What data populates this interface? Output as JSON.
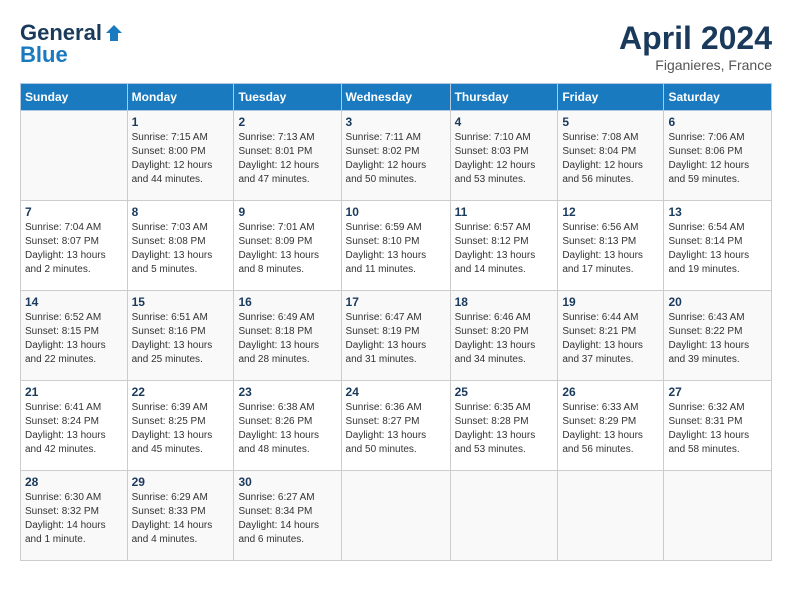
{
  "logo": {
    "general": "General",
    "blue": "Blue"
  },
  "title": "April 2024",
  "location": "Figanieres, France",
  "days_of_week": [
    "Sunday",
    "Monday",
    "Tuesday",
    "Wednesday",
    "Thursday",
    "Friday",
    "Saturday"
  ],
  "weeks": [
    [
      {
        "num": "",
        "sunrise": "",
        "sunset": "",
        "daylight": ""
      },
      {
        "num": "1",
        "sunrise": "Sunrise: 7:15 AM",
        "sunset": "Sunset: 8:00 PM",
        "daylight": "Daylight: 12 hours and 44 minutes."
      },
      {
        "num": "2",
        "sunrise": "Sunrise: 7:13 AM",
        "sunset": "Sunset: 8:01 PM",
        "daylight": "Daylight: 12 hours and 47 minutes."
      },
      {
        "num": "3",
        "sunrise": "Sunrise: 7:11 AM",
        "sunset": "Sunset: 8:02 PM",
        "daylight": "Daylight: 12 hours and 50 minutes."
      },
      {
        "num": "4",
        "sunrise": "Sunrise: 7:10 AM",
        "sunset": "Sunset: 8:03 PM",
        "daylight": "Daylight: 12 hours and 53 minutes."
      },
      {
        "num": "5",
        "sunrise": "Sunrise: 7:08 AM",
        "sunset": "Sunset: 8:04 PM",
        "daylight": "Daylight: 12 hours and 56 minutes."
      },
      {
        "num": "6",
        "sunrise": "Sunrise: 7:06 AM",
        "sunset": "Sunset: 8:06 PM",
        "daylight": "Daylight: 12 hours and 59 minutes."
      }
    ],
    [
      {
        "num": "7",
        "sunrise": "Sunrise: 7:04 AM",
        "sunset": "Sunset: 8:07 PM",
        "daylight": "Daylight: 13 hours and 2 minutes."
      },
      {
        "num": "8",
        "sunrise": "Sunrise: 7:03 AM",
        "sunset": "Sunset: 8:08 PM",
        "daylight": "Daylight: 13 hours and 5 minutes."
      },
      {
        "num": "9",
        "sunrise": "Sunrise: 7:01 AM",
        "sunset": "Sunset: 8:09 PM",
        "daylight": "Daylight: 13 hours and 8 minutes."
      },
      {
        "num": "10",
        "sunrise": "Sunrise: 6:59 AM",
        "sunset": "Sunset: 8:10 PM",
        "daylight": "Daylight: 13 hours and 11 minutes."
      },
      {
        "num": "11",
        "sunrise": "Sunrise: 6:57 AM",
        "sunset": "Sunset: 8:12 PM",
        "daylight": "Daylight: 13 hours and 14 minutes."
      },
      {
        "num": "12",
        "sunrise": "Sunrise: 6:56 AM",
        "sunset": "Sunset: 8:13 PM",
        "daylight": "Daylight: 13 hours and 17 minutes."
      },
      {
        "num": "13",
        "sunrise": "Sunrise: 6:54 AM",
        "sunset": "Sunset: 8:14 PM",
        "daylight": "Daylight: 13 hours and 19 minutes."
      }
    ],
    [
      {
        "num": "14",
        "sunrise": "Sunrise: 6:52 AM",
        "sunset": "Sunset: 8:15 PM",
        "daylight": "Daylight: 13 hours and 22 minutes."
      },
      {
        "num": "15",
        "sunrise": "Sunrise: 6:51 AM",
        "sunset": "Sunset: 8:16 PM",
        "daylight": "Daylight: 13 hours and 25 minutes."
      },
      {
        "num": "16",
        "sunrise": "Sunrise: 6:49 AM",
        "sunset": "Sunset: 8:18 PM",
        "daylight": "Daylight: 13 hours and 28 minutes."
      },
      {
        "num": "17",
        "sunrise": "Sunrise: 6:47 AM",
        "sunset": "Sunset: 8:19 PM",
        "daylight": "Daylight: 13 hours and 31 minutes."
      },
      {
        "num": "18",
        "sunrise": "Sunrise: 6:46 AM",
        "sunset": "Sunset: 8:20 PM",
        "daylight": "Daylight: 13 hours and 34 minutes."
      },
      {
        "num": "19",
        "sunrise": "Sunrise: 6:44 AM",
        "sunset": "Sunset: 8:21 PM",
        "daylight": "Daylight: 13 hours and 37 minutes."
      },
      {
        "num": "20",
        "sunrise": "Sunrise: 6:43 AM",
        "sunset": "Sunset: 8:22 PM",
        "daylight": "Daylight: 13 hours and 39 minutes."
      }
    ],
    [
      {
        "num": "21",
        "sunrise": "Sunrise: 6:41 AM",
        "sunset": "Sunset: 8:24 PM",
        "daylight": "Daylight: 13 hours and 42 minutes."
      },
      {
        "num": "22",
        "sunrise": "Sunrise: 6:39 AM",
        "sunset": "Sunset: 8:25 PM",
        "daylight": "Daylight: 13 hours and 45 minutes."
      },
      {
        "num": "23",
        "sunrise": "Sunrise: 6:38 AM",
        "sunset": "Sunset: 8:26 PM",
        "daylight": "Daylight: 13 hours and 48 minutes."
      },
      {
        "num": "24",
        "sunrise": "Sunrise: 6:36 AM",
        "sunset": "Sunset: 8:27 PM",
        "daylight": "Daylight: 13 hours and 50 minutes."
      },
      {
        "num": "25",
        "sunrise": "Sunrise: 6:35 AM",
        "sunset": "Sunset: 8:28 PM",
        "daylight": "Daylight: 13 hours and 53 minutes."
      },
      {
        "num": "26",
        "sunrise": "Sunrise: 6:33 AM",
        "sunset": "Sunset: 8:29 PM",
        "daylight": "Daylight: 13 hours and 56 minutes."
      },
      {
        "num": "27",
        "sunrise": "Sunrise: 6:32 AM",
        "sunset": "Sunset: 8:31 PM",
        "daylight": "Daylight: 13 hours and 58 minutes."
      }
    ],
    [
      {
        "num": "28",
        "sunrise": "Sunrise: 6:30 AM",
        "sunset": "Sunset: 8:32 PM",
        "daylight": "Daylight: 14 hours and 1 minute."
      },
      {
        "num": "29",
        "sunrise": "Sunrise: 6:29 AM",
        "sunset": "Sunset: 8:33 PM",
        "daylight": "Daylight: 14 hours and 4 minutes."
      },
      {
        "num": "30",
        "sunrise": "Sunrise: 6:27 AM",
        "sunset": "Sunset: 8:34 PM",
        "daylight": "Daylight: 14 hours and 6 minutes."
      },
      {
        "num": "",
        "sunrise": "",
        "sunset": "",
        "daylight": ""
      },
      {
        "num": "",
        "sunrise": "",
        "sunset": "",
        "daylight": ""
      },
      {
        "num": "",
        "sunrise": "",
        "sunset": "",
        "daylight": ""
      },
      {
        "num": "",
        "sunrise": "",
        "sunset": "",
        "daylight": ""
      }
    ]
  ]
}
